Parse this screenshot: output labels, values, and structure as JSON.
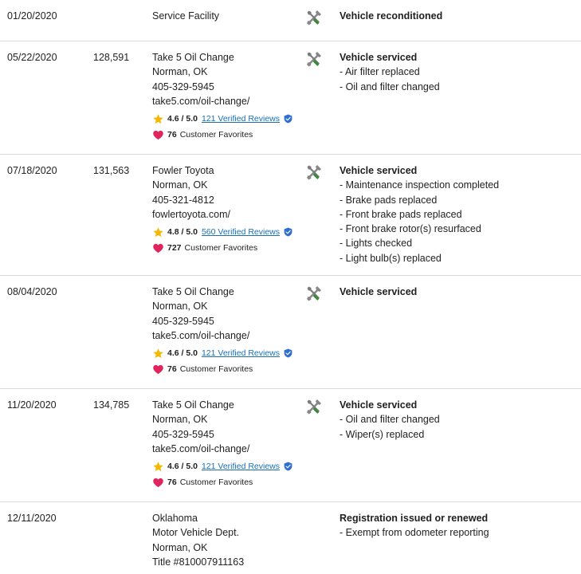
{
  "records": [
    {
      "date": "01/20/2020",
      "mileage": "",
      "source_lines": [
        "Service Facility"
      ],
      "details_title": "Vehicle reconditioned",
      "details_items": [],
      "icon": "tools-icon"
    },
    {
      "date": "05/22/2020",
      "mileage": "128,591",
      "source_lines": [
        "Take 5 Oil Change",
        "Norman, OK",
        "405-329-5945",
        "take5.com/oil-change/"
      ],
      "rating": {
        "score": "4.6 / 5.0",
        "reviews": "121 Verified Reviews",
        "favorites_count": "76",
        "favorites_label": "Customer Favorites"
      },
      "details_title": "Vehicle serviced",
      "details_items": [
        "- Air filter replaced",
        "- Oil and filter changed"
      ],
      "icon": "tools-icon"
    },
    {
      "date": "07/18/2020",
      "mileage": "131,563",
      "source_lines": [
        "Fowler Toyota",
        "Norman, OK",
        "405-321-4812",
        "fowlertoyota.com/"
      ],
      "rating": {
        "score": "4.8 / 5.0",
        "reviews": "560 Verified Reviews",
        "favorites_count": "727",
        "favorites_label": "Customer Favorites"
      },
      "details_title": "Vehicle serviced",
      "details_items": [
        "- Maintenance inspection completed",
        "- Brake pads replaced",
        "- Front brake pads replaced",
        "- Front brake rotor(s) resurfaced",
        "- Lights checked",
        "- Light bulb(s) replaced"
      ],
      "icon": "tools-icon"
    },
    {
      "date": "08/04/2020",
      "mileage": "",
      "source_lines": [
        "Take 5 Oil Change",
        "Norman, OK",
        "405-329-5945",
        "take5.com/oil-change/"
      ],
      "rating": {
        "score": "4.6 / 5.0",
        "reviews": "121 Verified Reviews",
        "favorites_count": "76",
        "favorites_label": "Customer Favorites"
      },
      "details_title": "Vehicle serviced",
      "details_items": [],
      "icon": "tools-icon"
    },
    {
      "date": "11/20/2020",
      "mileage": "134,785",
      "source_lines": [
        "Take 5 Oil Change",
        "Norman, OK",
        "405-329-5945",
        "take5.com/oil-change/"
      ],
      "rating": {
        "score": "4.6 / 5.0",
        "reviews": "121 Verified Reviews",
        "favorites_count": "76",
        "favorites_label": "Customer Favorites"
      },
      "details_title": "Vehicle serviced",
      "details_items": [
        "- Oil and filter changed",
        "- Wiper(s) replaced"
      ],
      "icon": "tools-icon"
    },
    {
      "date": "12/11/2020",
      "mileage": "",
      "source_lines": [
        "Oklahoma",
        "Motor Vehicle Dept.",
        "Norman, OK",
        "Title #810007911163"
      ],
      "details_title": "Registration issued or renewed",
      "details_items": [
        "- Exempt from odometer reporting"
      ],
      "icon": ""
    }
  ],
  "colors": {
    "star": "#f5b800",
    "heart": "#e0245e",
    "link": "#1a6fb3",
    "shield": "#2f6fcf",
    "wrench": "#7a7a7a",
    "screwdriver": "#3a8a3a"
  }
}
